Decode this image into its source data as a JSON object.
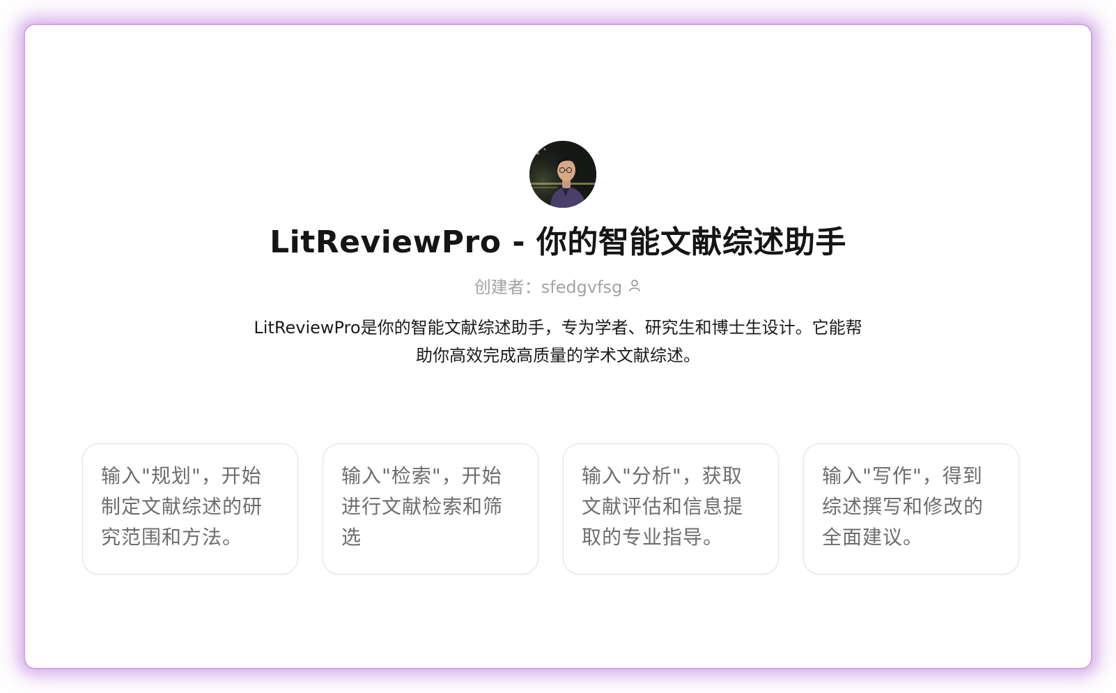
{
  "bot": {
    "name_title": "LitReviewPro - 你的智能文献综述助手",
    "creator_label": "创建者：",
    "creator_name": "sfedgvfsg",
    "description": "LitReviewPro是你的智能文献综述助手，专为学者、研究生和博士生设计。它能帮助你高效完成高质量的学术文献综述。",
    "avatar_icon": "user-avatar-photo"
  },
  "prompts": [
    {
      "text": "输入\"规划\"，开始制定文献综述的研究范围和方法。"
    },
    {
      "text": "输入\"检索\"，开始进行文献检索和筛选"
    },
    {
      "text": "输入\"分析\"，获取文献评估和信息提取的专业指导。"
    },
    {
      "text": "输入\"写作\"，得到综述撰写和修改的全面建议。"
    }
  ],
  "colors": {
    "frame_glow": "#c48cde",
    "title": "#151515",
    "muted": "#a3a3a3",
    "card_text": "#6d6d6d",
    "card_border": "#e3e3e3"
  }
}
